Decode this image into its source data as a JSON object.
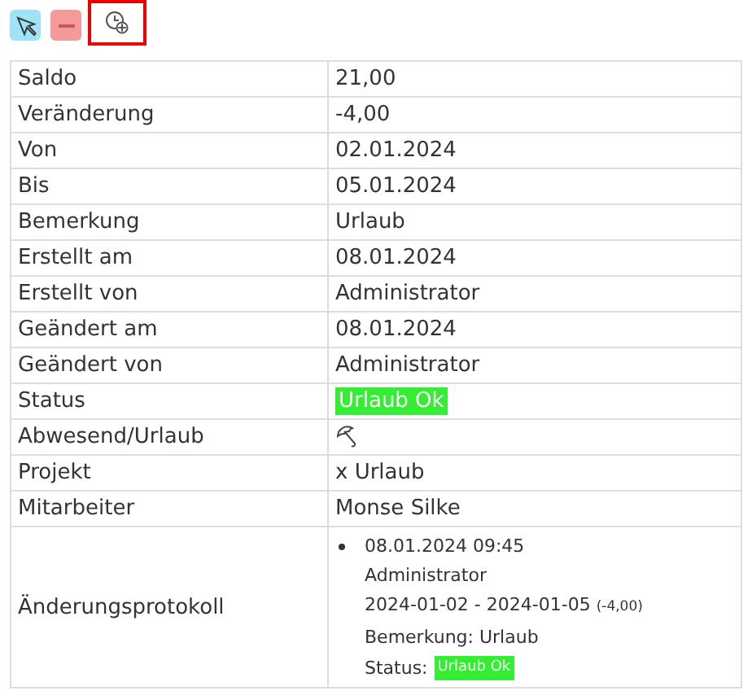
{
  "toolbar": [
    {
      "kind": "pointer",
      "selected": false
    },
    {
      "kind": "minus",
      "selected": false
    },
    {
      "kind": "clock",
      "selected": true
    }
  ],
  "rows": [
    {
      "label": "Saldo",
      "kind": "text",
      "value": "21,00"
    },
    {
      "label": "Veränderung",
      "kind": "text",
      "value": "-4,00"
    },
    {
      "label": "Von",
      "kind": "text",
      "value": "02.01.2024"
    },
    {
      "label": "Bis",
      "kind": "text",
      "value": "05.01.2024"
    },
    {
      "label": "Bemerkung",
      "kind": "text",
      "value": "Urlaub"
    },
    {
      "label": "Erstellt am",
      "kind": "text",
      "value": "08.01.2024"
    },
    {
      "label": "Erstellt von",
      "kind": "text",
      "value": "Administrator"
    },
    {
      "label": "Geändert am",
      "kind": "text",
      "value": "08.01.2024"
    },
    {
      "label": "Geändert von",
      "kind": "text",
      "value": "Administrator"
    },
    {
      "label": "Status",
      "kind": "badge",
      "value": "Urlaub Ok",
      "color": "#33ee33"
    },
    {
      "label": "Abwesend/Urlaub",
      "kind": "umbrella"
    },
    {
      "label": "Projekt",
      "kind": "text",
      "value": "x Urlaub"
    },
    {
      "label": "Mitarbeiter",
      "kind": "text",
      "value": "Monse Silke"
    },
    {
      "label": "Änderungsprotokoll",
      "kind": "log",
      "entries": [
        {
          "time": "08.01.2024 09:45",
          "user": "Administrator",
          "range": "2024-01-02 - 2024-01-05",
          "change": "(-4,00)",
          "remark": "Bemerkung: Urlaub",
          "status_label": "Status:",
          "status": "Urlaub Ok",
          "color": "#33ee33"
        }
      ]
    }
  ]
}
